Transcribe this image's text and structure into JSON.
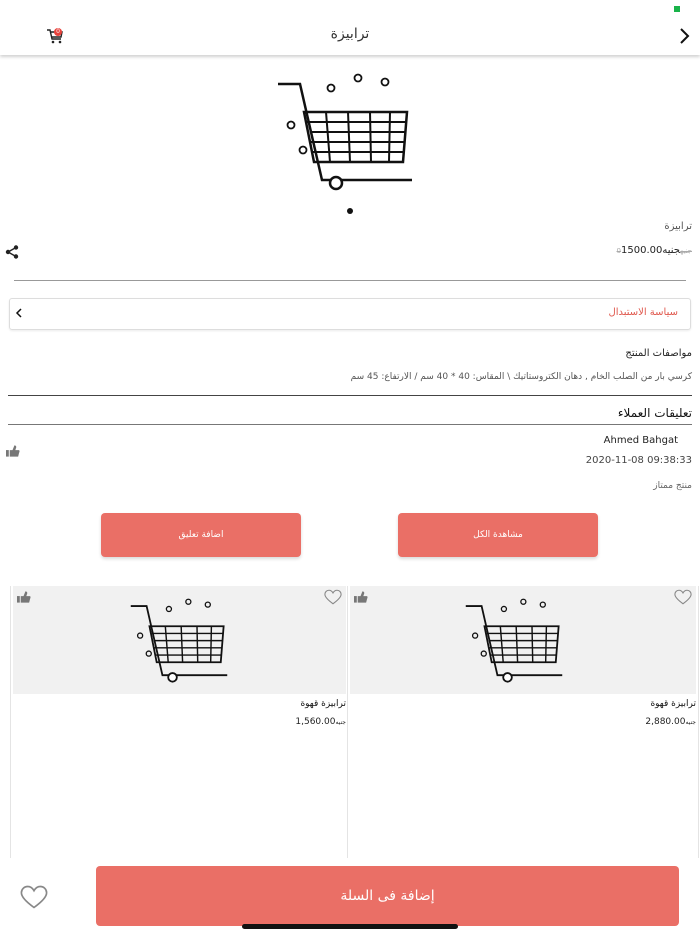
{
  "header": {
    "title": "ترابيزة",
    "cart_badge": "0"
  },
  "product": {
    "name": "ترابيزة",
    "price": "1500.00",
    "currency": "جنيه",
    "old_price": "0جنيه"
  },
  "policy": {
    "label": "سياسة الاستبدال"
  },
  "specs": {
    "title": "مواصفات المنتج",
    "text": "كرسي بار من الصلب الخام , دهان الكتروستاتيك \\ المقاس: 40 * 40 سم / الارتفاع: 45 سم"
  },
  "reviews": {
    "title": "تعليقات العملاء",
    "items": [
      {
        "name": "Ahmed Bahgat",
        "date": "2020-11-08 09:38:33",
        "text": "منتج ممتاز"
      }
    ],
    "add_comment_label": "اضافة تعليق",
    "view_all_label": "مشاهدة الكل"
  },
  "related": [
    {
      "name": "ترابيزة قهوة",
      "price": "1,560.00",
      "currency": "جنيه"
    },
    {
      "name": "ترابيزة قهوة",
      "price": "2,880.00",
      "currency": "جنيه"
    }
  ],
  "bottom": {
    "add_to_cart_label": "إضافة فى السلة"
  },
  "colors": {
    "accent": "#ea6f66",
    "badge": "#e8423c"
  },
  "icons": [
    "back-arrow-icon",
    "cart-icon",
    "share-icon",
    "chevron-left-icon",
    "thumbs-up-icon",
    "heart-icon",
    "cart-placeholder-image"
  ]
}
